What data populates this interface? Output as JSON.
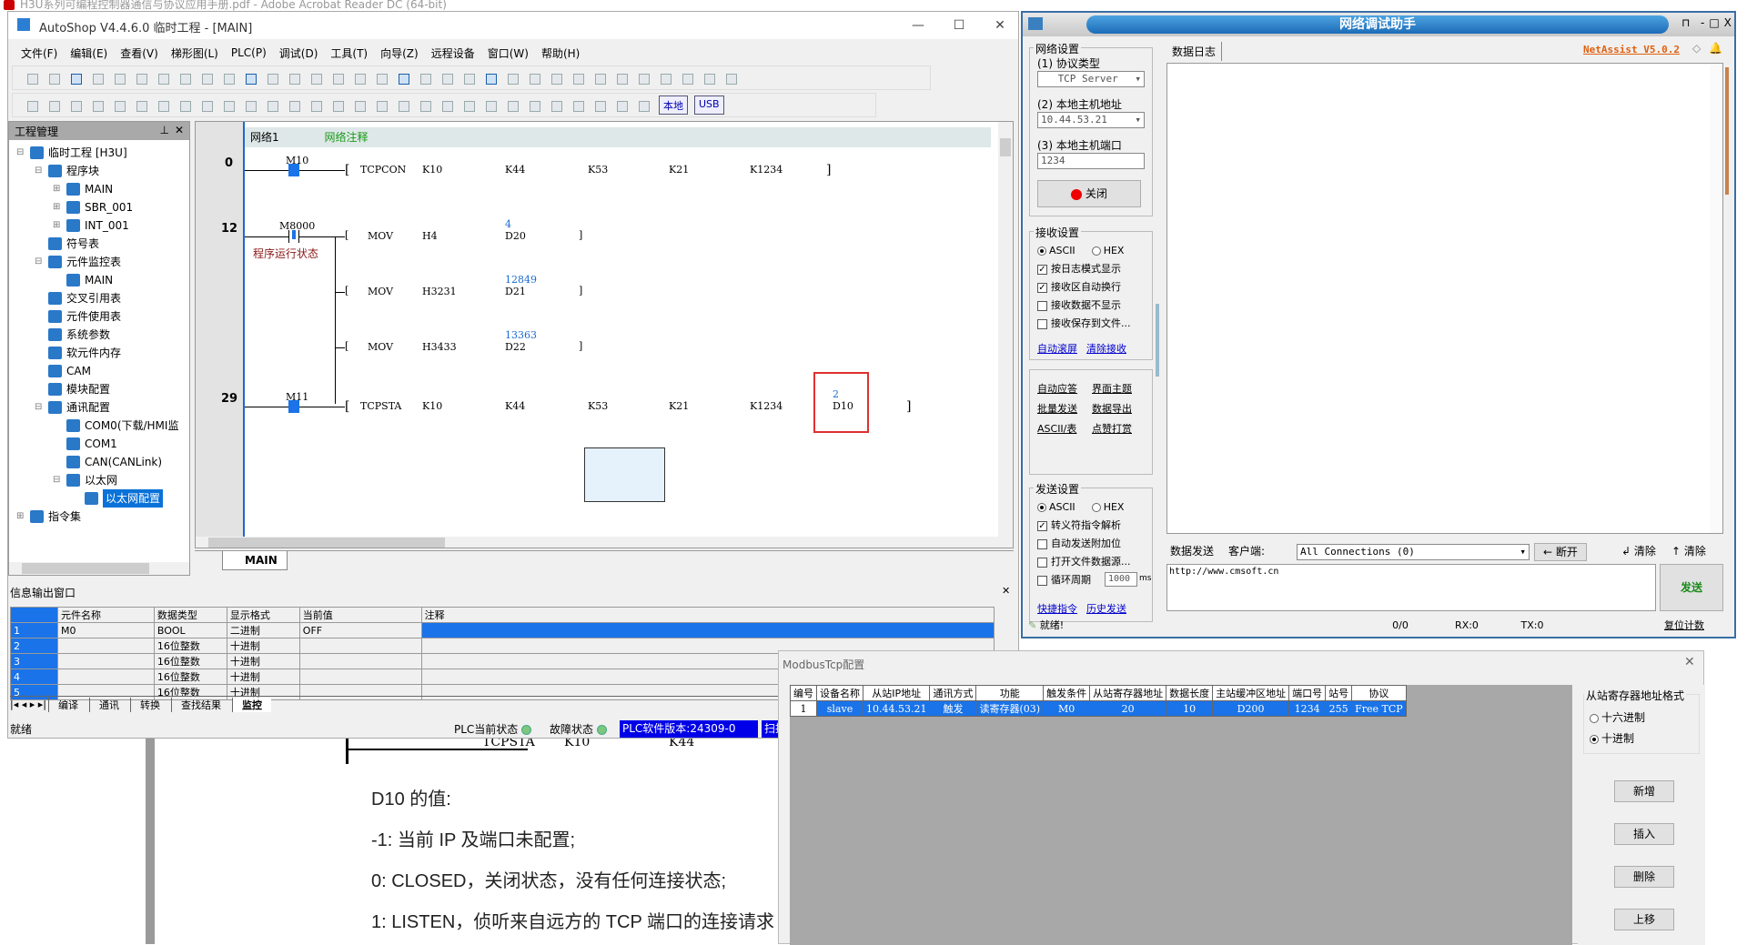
{
  "acrobat": {
    "title": "H3U系列可编程控制器通信与协议应用手册.pdf - Adobe Acrobat Reader DC (64-bit)"
  },
  "autoshop": {
    "title": "AutoShop V4.4.6.0  临时工程 - [MAIN]",
    "menu": [
      "文件(F)",
      "编辑(E)",
      "查看(V)",
      "梯形图(L)",
      "PLC(P)",
      "调试(D)",
      "工具(T)",
      "向导(Z)",
      "远程设备",
      "窗口(W)",
      "帮助(H)"
    ],
    "toolbar1": [
      "new-icon",
      "open-icon",
      "save-icon",
      "save-all-icon",
      "cut-icon",
      "copy-icon",
      "paste-icon",
      "undo-icon",
      "redo-icon",
      "delete-icon",
      "search-icon",
      "print-preview-icon",
      "print-icon",
      "window-icon",
      "window-switch-icon",
      "import-icon",
      "export-icon",
      "run-icon",
      "stop-icon",
      "download-icon",
      "upload-icon",
      "monitor-icon",
      "trace-icon",
      "edit-monitor-icon",
      "write-icon",
      "compare-icon",
      "compare2-icon",
      "align-icon",
      "align2-icon",
      "network-icon",
      "login-icon",
      "logout-icon",
      "panel-icon"
    ],
    "toolbar2": [
      "lad-icon",
      "sfc-icon",
      "st-icon",
      "insert-row-icon",
      "down-arrow-icon",
      "down-outline-icon",
      "insert-col-icon",
      "branch-icon",
      "branch2-icon",
      "branch3-icon",
      "hline-icon",
      "vline-icon",
      "corner-icon",
      "corner2-icon",
      "no-contact-icon",
      "nc-contact-icon",
      "rising-icon",
      "falling-icon",
      "set-icon",
      "coil-c-icon",
      "coil-icon",
      "func-a-icon",
      "func-f-icon",
      "dash-icon",
      "bar-icon",
      "slash-icon",
      "cross-icon",
      "up-icon",
      "down-icon"
    ],
    "toolbar2_labels": {
      "local": "本地",
      "usb": "USB"
    },
    "project": {
      "title": "工程管理",
      "items": [
        {
          "label": "临时工程 [H3U]",
          "level": 0,
          "icon": "computer-icon"
        },
        {
          "label": "程序块",
          "level": 1,
          "icon": "blocks-icon"
        },
        {
          "label": "MAIN",
          "level": 2,
          "icon": "program-icon"
        },
        {
          "label": "SBR_001",
          "level": 2,
          "icon": "program-icon"
        },
        {
          "label": "INT_001",
          "level": 2,
          "icon": "program-icon"
        },
        {
          "label": "符号表",
          "level": 1,
          "icon": "symbol-table-icon"
        },
        {
          "label": "元件监控表",
          "level": 1,
          "icon": "monitor-table-icon"
        },
        {
          "label": "MAIN",
          "level": 2,
          "icon": "list-icon"
        },
        {
          "label": "交叉引用表",
          "level": 1,
          "icon": "cross-ref-icon"
        },
        {
          "label": "元件使用表",
          "level": 1,
          "icon": "database-icon"
        },
        {
          "label": "系统参数",
          "level": 1,
          "icon": "globe-icon"
        },
        {
          "label": "软元件内存",
          "level": 1,
          "icon": "memory-icon"
        },
        {
          "label": "CAM",
          "level": 1,
          "icon": "cam-icon"
        },
        {
          "label": "模块配置",
          "level": 1,
          "icon": "gear-list-icon"
        },
        {
          "label": "通讯配置",
          "level": 1,
          "icon": "gear-list-icon"
        },
        {
          "label": "COM0(下载/HMI监",
          "level": 2,
          "icon": "serial-port-icon"
        },
        {
          "label": "COM1",
          "level": 2,
          "icon": "serial-port-icon"
        },
        {
          "label": "CAN(CANLink)",
          "level": 2,
          "icon": "can-network-icon"
        },
        {
          "label": "以太网",
          "level": 2,
          "icon": "ethernet-icon"
        },
        {
          "label": "以太网配置",
          "level": 3,
          "icon": "gear-list-icon",
          "selected": true
        },
        {
          "label": "指令集",
          "level": 0,
          "icon": "computer-icon"
        }
      ]
    },
    "ladder": {
      "network_label": "网络1",
      "network_comment": "网络注释",
      "rungs": [
        {
          "num": "0",
          "contact": "M10",
          "instr": "TCPCON",
          "ops": [
            "K10",
            "K44",
            "K53",
            "K21",
            "K1234"
          ]
        },
        {
          "num": "12",
          "contact": "M8000",
          "contact_comment": "程序运行状态",
          "movs": [
            {
              "instr": "MOV",
              "src": "H4",
              "dst": "D20",
              "value": "4"
            },
            {
              "instr": "MOV",
              "src": "H3231",
              "dst": "D21",
              "value": "12849"
            },
            {
              "instr": "MOV",
              "src": "H3433",
              "dst": "D22",
              "value": "13363"
            }
          ]
        },
        {
          "num": "29",
          "contact": "M11",
          "instr": "TCPSTA",
          "ops": [
            "K10",
            "K44",
            "K53",
            "K21",
            "K1234"
          ],
          "dst": "D10",
          "dst_value": "2"
        }
      ],
      "tab": "MAIN"
    },
    "info": {
      "title": "信息输出窗口",
      "headers": [
        "",
        "元件名称",
        "数据类型",
        "显示格式",
        "当前值",
        "注释"
      ],
      "rows": [
        [
          "1",
          "M0",
          "BOOL",
          "二进制",
          "OFF",
          ""
        ],
        [
          "2",
          "",
          "16位整数",
          "十进制",
          "",
          ""
        ],
        [
          "3",
          "",
          "16位整数",
          "十进制",
          "",
          ""
        ],
        [
          "4",
          "",
          "16位整数",
          "十进制",
          "",
          ""
        ],
        [
          "5",
          "",
          "16位整数",
          "十进制",
          "",
          ""
        ]
      ],
      "tabs": [
        "编译",
        "通讯",
        "转换",
        "查找结果",
        "监控"
      ]
    },
    "status": {
      "ready": "就绪",
      "plc_state": "PLC当前状态",
      "fault_state": "故障状态",
      "version": "PLC软件版本:24309-0",
      "scan": "扫描"
    }
  },
  "pdf": {
    "lines": [
      "D10 的值:",
      "-1: 当前 IP 及端口未配置;",
      "0: CLOSED，关闭状态，没有任何连接状态;",
      "1: LISTEN，侦听来自远方的 TCP 端口的连接请求"
    ],
    "ladder_fragment": [
      "TCPSTA",
      "K10",
      "K44"
    ]
  },
  "netassist": {
    "title": "网络调试助手",
    "brand": "NetAssist V5.0.2",
    "net_settings": {
      "title": "网络设置",
      "protocol_label": "(1) 协议类型",
      "protocol": "TCP Server",
      "host_label": "(2) 本地主机地址",
      "host": "10.44.53.21",
      "port_label": "(3) 本地主机端口",
      "port": "1234",
      "close": "关闭"
    },
    "recv": {
      "title": "接收设置",
      "ascii": "ASCII",
      "hex": "HEX",
      "opts": [
        {
          "label": "按日志模式显示",
          "checked": true
        },
        {
          "label": "接收区自动换行",
          "checked": true
        },
        {
          "label": "接收数据不显示",
          "checked": false
        },
        {
          "label": "接收保存到文件...",
          "checked": false
        }
      ],
      "links": [
        "自动滚屏",
        "清除接收"
      ]
    },
    "tools": [
      "自动应答",
      "界面主题",
      "批量发送",
      "数据导出",
      "ASCII/表",
      "点赞打赏"
    ],
    "send": {
      "title": "发送设置",
      "ascii": "ASCII",
      "hex": "HEX",
      "opts": [
        {
          "label": "转义符指令解析",
          "checked": true
        },
        {
          "label": "自动发送附加位",
          "checked": false
        },
        {
          "label": "打开文件数据源...",
          "checked": false
        },
        {
          "label": "循环周期",
          "checked": false
        }
      ],
      "period": "1000",
      "unit": "ms",
      "links": [
        "快捷指令",
        "历史发送"
      ]
    },
    "log_tab": "数据日志",
    "send_tab": "数据发送",
    "client_label": "客户端:",
    "client": "All Connections (0)",
    "disconnect": "断开",
    "clear1": "清除",
    "clear2": "清除",
    "send_text": "http://www.cmsoft.cn",
    "send_btn": "发送",
    "statusbar": {
      "ready": "就绪!",
      "count": "0/0",
      "rx": "RX:0",
      "tx": "TX:0",
      "reset": "复位计数"
    }
  },
  "modbus": {
    "title": "ModbusTcp配置",
    "headers": [
      "编号",
      "设备名称",
      "从站IP地址",
      "通讯方式",
      "功能",
      "触发条件",
      "从站寄存器地址",
      "数据长度",
      "主站缓冲区地址",
      "端口号",
      "站号",
      "协议"
    ],
    "rows": [
      [
        "1",
        "slave",
        "10.44.53.21",
        "触发",
        "读寄存器(03)",
        "M0",
        "20",
        "10",
        "D200",
        "1234",
        "255",
        "Free TCP"
      ]
    ],
    "format_title": "从站寄存器地址格式",
    "hex": "十六进制",
    "dec": "十进制",
    "format": "dec",
    "buttons": [
      "新增",
      "插入",
      "删除",
      "上移"
    ]
  }
}
